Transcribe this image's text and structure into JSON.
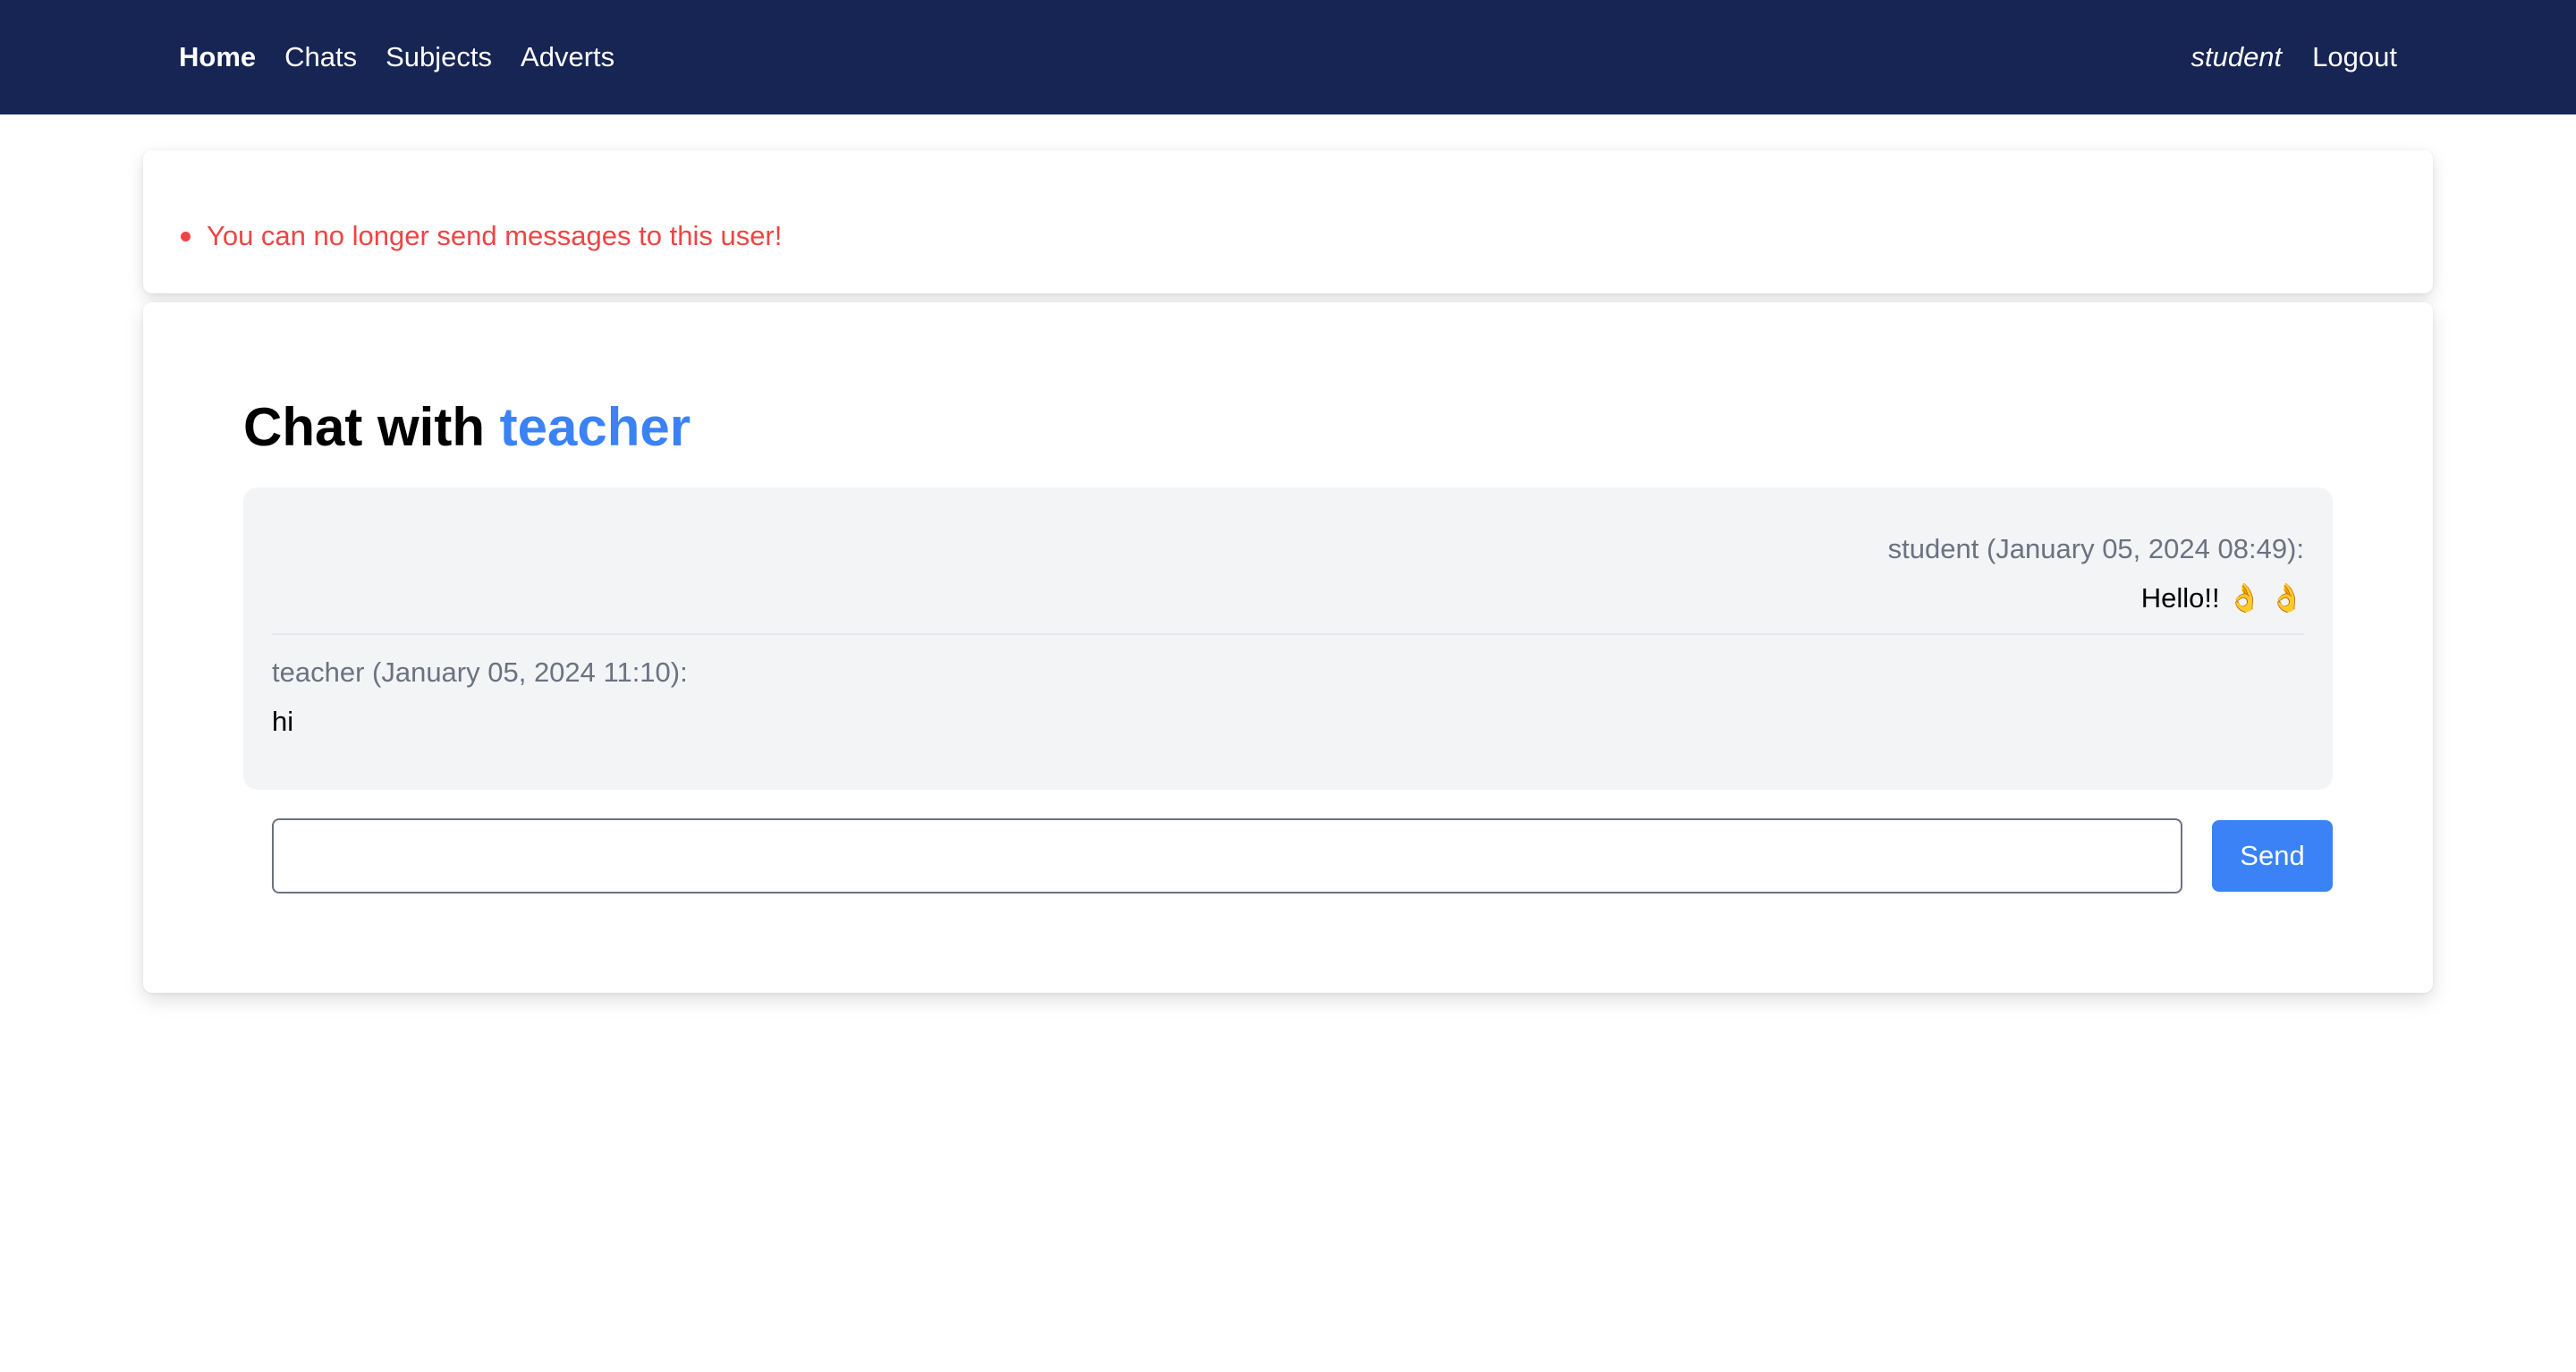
{
  "nav": {
    "links": [
      {
        "label": "Home",
        "active": true
      },
      {
        "label": "Chats",
        "active": false
      },
      {
        "label": "Subjects",
        "active": false
      },
      {
        "label": "Adverts",
        "active": false
      }
    ],
    "user": "student",
    "logout_label": "Logout"
  },
  "errors": [
    "You can no longer send messages to this user!"
  ],
  "chat": {
    "title_prefix": "Chat with",
    "partner": "teacher",
    "messages": [
      {
        "meta": "student (January 05, 2024 08:49):",
        "text": "Hello!! 👌 👌",
        "own": true
      },
      {
        "meta": "teacher (January 05, 2024 11:10):",
        "text": "hi",
        "own": false
      }
    ],
    "input_value": "",
    "input_placeholder": "",
    "send_label": "Send"
  },
  "colors": {
    "navbar_bg": "#172554",
    "accent": "#3b82f6",
    "error": "#ef4444",
    "messages_bg": "#f3f4f6",
    "meta_text": "#6b7280"
  }
}
